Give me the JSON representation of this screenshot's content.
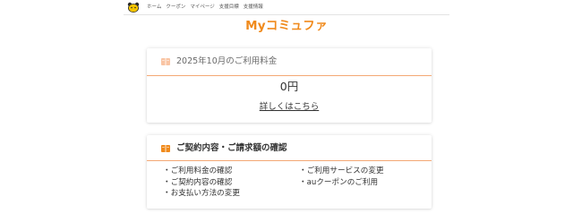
{
  "colors": {
    "accent": "#f08a1c",
    "divider": "#f3a875"
  },
  "header": {
    "mascot_icon": "mascot-icon",
    "nav": [
      "ホーム",
      "クーポン",
      "マイページ",
      "支援目標",
      "支援情報"
    ]
  },
  "logo": "Myコミュファ",
  "billing": {
    "icon": "book-icon",
    "title": "2025年10月のご利用料金",
    "amount": "0円",
    "detail_link": "詳しくはこちら"
  },
  "contract": {
    "icon": "book-icon",
    "title": "ご契約内容・ご請求額の確認",
    "links_left": [
      "ご利用料金の確認",
      "ご契約内容の確認",
      "お支払い方法の変更"
    ],
    "links_right": [
      "ご利用サービスの変更",
      "auクーポンのご利用"
    ]
  }
}
